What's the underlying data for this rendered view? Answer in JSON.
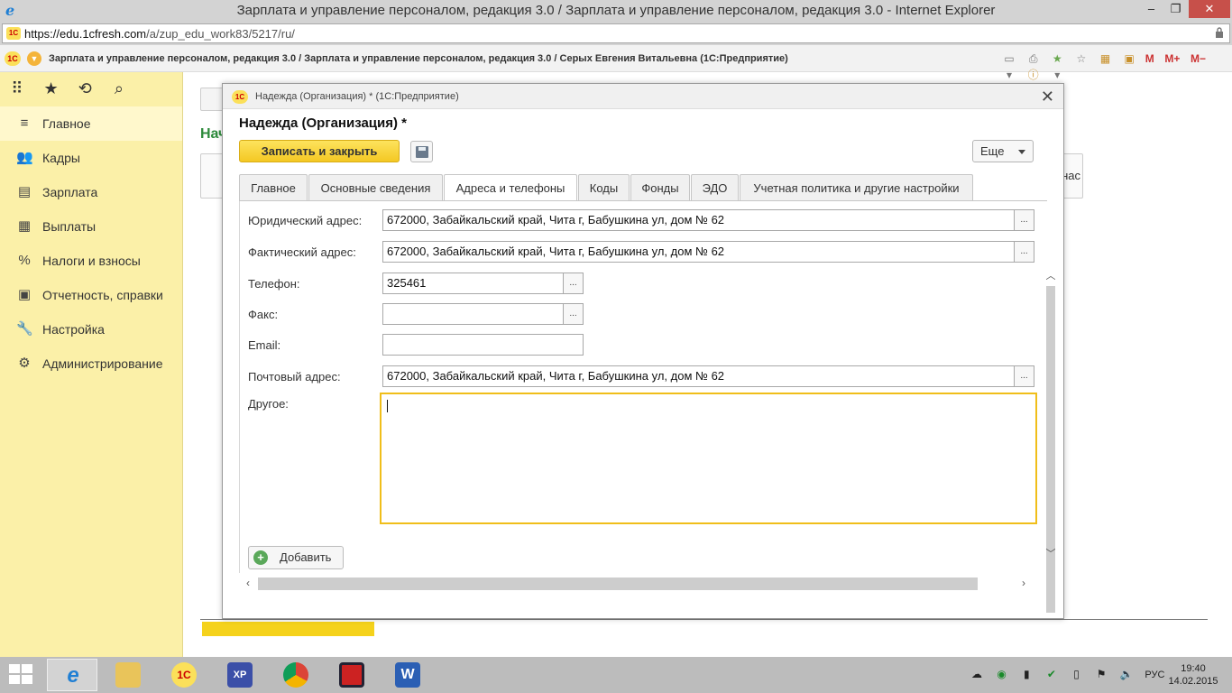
{
  "browser": {
    "window_title": "Зарплата и управление персоналом, редакция 3.0 / Зарплата и управление персоналом, редакция 3.0 - Internet Explorer",
    "url_host": "https://edu.1cfresh.com",
    "url_path": "/a/zup_edu_work83/5217/ru/",
    "minimize": "–",
    "maximize": "❐",
    "close": "✕"
  },
  "app": {
    "title": "Зарплата и управление персоналом, редакция 3.0 / Зарплата и управление персоналом, редакция 3.0 / Серых Евгения Витальевна  (1С:Предприятие)",
    "logo_text": "1С",
    "m_buttons": [
      "M",
      "M+",
      "M−"
    ]
  },
  "sidebar": {
    "items": [
      {
        "label": "Главное",
        "icon": "≡"
      },
      {
        "label": "Кадры",
        "icon": "👥"
      },
      {
        "label": "Зарплата",
        "icon": "▤"
      },
      {
        "label": "Выплаты",
        "icon": "▦"
      },
      {
        "label": "Налоги и взносы",
        "icon": "%"
      },
      {
        "label": "Отчетность, справки",
        "icon": "▣"
      },
      {
        "label": "Настройка",
        "icon": "🔧"
      },
      {
        "label": "Администрирование",
        "icon": "⚙"
      }
    ]
  },
  "background": {
    "title_fragment": "Нач",
    "side_fragment": "нас"
  },
  "dialog": {
    "header_title": "Надежда (Организация) * (1С:Предприятие)",
    "title": "Надежда (Организация) *",
    "save_close_label": "Записать и закрыть",
    "more_label": "Еще",
    "close_symbol": "✕",
    "tabs": [
      "Главное",
      "Основные сведения",
      "Адреса и телефоны",
      "Коды",
      "Фонды",
      "ЭДО",
      "Учетная политика и другие настройки"
    ],
    "active_tab": 2,
    "fields": {
      "legal_address": {
        "label": "Юридический адрес:",
        "value": "672000, Забайкальский край, Чита г, Бабушкина ул, дом № 62"
      },
      "actual_address": {
        "label": "Фактический адрес:",
        "value": "672000, Забайкальский край, Чита г, Бабушкина ул, дом № 62"
      },
      "phone": {
        "label": "Телефон:",
        "value": "325461"
      },
      "fax": {
        "label": "Факс:",
        "value": ""
      },
      "email": {
        "label": "Email:",
        "value": ""
      },
      "postal_address": {
        "label": "Почтовый адрес:",
        "value": "672000, Забайкальский край, Чита г, Бабушкина ул, дом № 62"
      },
      "other": {
        "label": "Другое:",
        "value": ""
      }
    },
    "dots_label": "...",
    "add_label": "Добавить"
  },
  "taskbar": {
    "language": "РУС",
    "time": "19:40",
    "date": "14.02.2015"
  }
}
